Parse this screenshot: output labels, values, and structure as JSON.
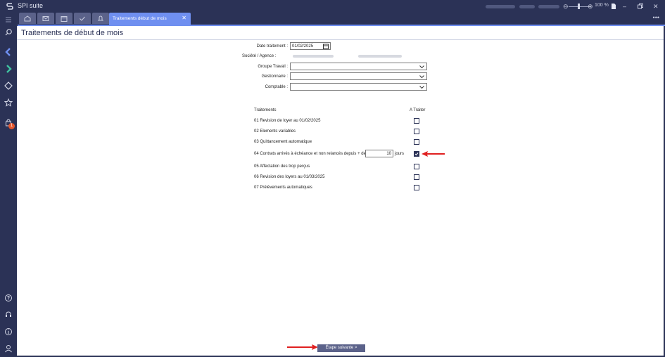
{
  "app": {
    "title": "SPI suite",
    "zoom": "100 %"
  },
  "tabs": {
    "active_label": "Traitements début de mois",
    "close": "✕",
    "more": "•••"
  },
  "sidebar": {
    "badge": "1"
  },
  "page": {
    "title": "Traitements de début de mois"
  },
  "form": {
    "date_label": "Date traitement :",
    "date_value": "01/02/2025",
    "societe_label": "Société / Agence :",
    "groupe_label": "Groupe Travail :",
    "gestionnaire_label": "Gestionnaire :",
    "comptable_label": "Comptable :"
  },
  "traitements": {
    "header_left": "Traitements",
    "header_right": "A Traiter",
    "rows": [
      {
        "label": "01 Revision de loyer au 01/02/2025",
        "checked": false
      },
      {
        "label": "02 Elements variables",
        "checked": false
      },
      {
        "label": "03 Quittancement automatique",
        "checked": false
      },
      {
        "label": "04 Contrats arrivés à échéance et non relancés depuis + de",
        "checked": true
      },
      {
        "label": "05 Affectation des trop perçus",
        "checked": false
      },
      {
        "label": "06 Revision des loyers au 01/03/2025",
        "checked": false
      },
      {
        "label": "07 Prélèvements automatiques",
        "checked": false
      }
    ],
    "days_value": "10",
    "days_unit": "jours"
  },
  "footer": {
    "next_label": "Étape suivante >"
  },
  "colors": {
    "accent": "#6f8ff0",
    "navy": "#2b3256",
    "arrow": "#e02020"
  }
}
